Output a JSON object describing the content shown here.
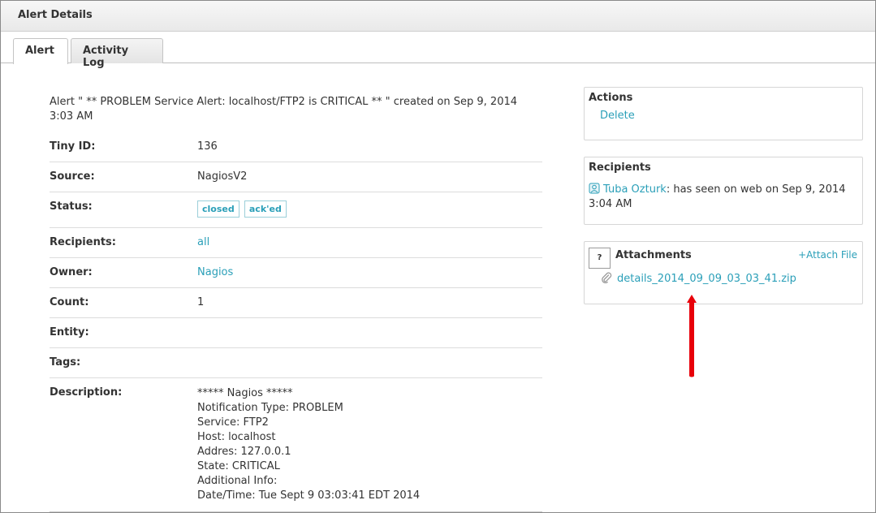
{
  "header": {
    "title": "Alert Details"
  },
  "tabs": [
    {
      "label": "Alert",
      "active": true
    },
    {
      "label": "Activity Log",
      "active": false
    }
  ],
  "alert": {
    "summary": "Alert \" ** PROBLEM Service Alert: localhost/FTP2 is CRITICAL ** \" created on Sep 9, 2014 3:03 AM",
    "fields": {
      "tiny_id": {
        "label": "Tiny ID:",
        "value": "136"
      },
      "source": {
        "label": "Source:",
        "value": "NagiosV2"
      },
      "status": {
        "label": "Status:",
        "badges": [
          "closed",
          "ack'ed"
        ]
      },
      "recipients": {
        "label": "Recipients:",
        "value": "all"
      },
      "owner": {
        "label": "Owner:",
        "value": "Nagios"
      },
      "count": {
        "label": "Count:",
        "value": "1"
      },
      "entity": {
        "label": "Entity:",
        "value": ""
      },
      "tags": {
        "label": "Tags:",
        "value": ""
      },
      "description": {
        "label": "Description:",
        "lines": [
          "***** Nagios *****",
          "Notification Type: PROBLEM",
          "Service: FTP2",
          "Host: localhost",
          "Addres: 127.0.0.1",
          "State: CRITICAL",
          "Additional Info:",
          "Date/Time: Tue Sept 9 03:03:41 EDT 2014"
        ]
      }
    }
  },
  "actions_panel": {
    "title": "Actions",
    "delete_label": "Delete"
  },
  "recipients_panel": {
    "title": "Recipients",
    "user_icon": "user-icon",
    "user": "Tuba Ozturk",
    "status_text": ": has seen on web on Sep 9, 2014",
    "status_text_line2": "3:04 AM"
  },
  "attachments_panel": {
    "help_label": "?",
    "title": "Attachments",
    "attach_label": "+Attach File",
    "file_icon": "paperclip-icon",
    "file_name": "details_2014_09_09_03_03_41.zip"
  },
  "annotation": {
    "arrow_color": "#e8000a"
  },
  "colors": {
    "link": "#2a9fb8",
    "text": "#333333"
  }
}
